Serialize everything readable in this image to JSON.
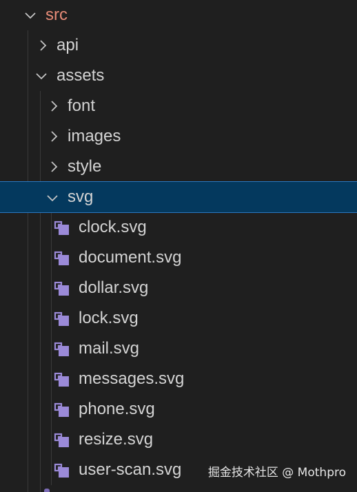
{
  "tree": {
    "root": {
      "label": "src",
      "expanded": true
    },
    "api": {
      "label": "api",
      "expanded": false
    },
    "assets": {
      "label": "assets",
      "expanded": true
    },
    "font": {
      "label": "font",
      "expanded": false
    },
    "images": {
      "label": "images",
      "expanded": false
    },
    "style": {
      "label": "style",
      "expanded": false
    },
    "svg": {
      "label": "svg",
      "expanded": true,
      "selected": true
    },
    "files": [
      {
        "label": "clock.svg",
        "icon": "svg-file-icon"
      },
      {
        "label": "document.svg",
        "icon": "svg-file-icon"
      },
      {
        "label": "dollar.svg",
        "icon": "svg-file-icon"
      },
      {
        "label": "lock.svg",
        "icon": "svg-file-icon"
      },
      {
        "label": "mail.svg",
        "icon": "svg-file-icon"
      },
      {
        "label": "messages.svg",
        "icon": "svg-file-icon"
      },
      {
        "label": "phone.svg",
        "icon": "svg-file-icon"
      },
      {
        "label": "resize.svg",
        "icon": "svg-file-icon"
      },
      {
        "label": "user-scan.svg",
        "icon": "svg-file-icon"
      }
    ]
  },
  "watermark": "掘金技术社区 @ Mothpro",
  "colors": {
    "background": "#1f1f1f",
    "text": "#d4d4d4",
    "root_text": "#e78c78",
    "selection_bg": "#04395e",
    "selection_border": "#2b79c2",
    "svg_icon": "#9b8ad8"
  }
}
